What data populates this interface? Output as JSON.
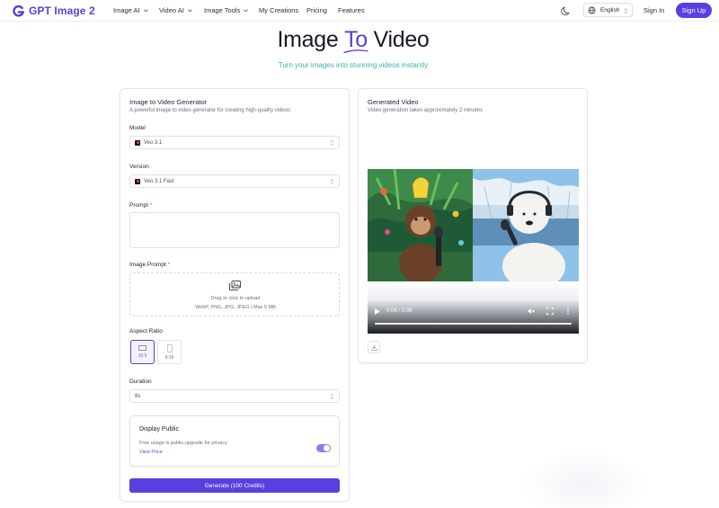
{
  "nav": {
    "logo_text": "GPT Image 2",
    "items": [
      {
        "label": "Image AI",
        "has_chevron": true
      },
      {
        "label": "Video AI",
        "has_chevron": true
      },
      {
        "label": "Image Tools",
        "has_chevron": true
      },
      {
        "label": "My Creations",
        "has_chevron": false
      },
      {
        "label": "Pricing",
        "has_chevron": false
      },
      {
        "label": "Features",
        "has_chevron": false
      }
    ],
    "language": "English",
    "sign_in": "Sign In",
    "sign_up": "Sign Up"
  },
  "hero": {
    "title_prefix": "Image ",
    "title_accent": "To",
    "title_suffix": " Video",
    "subtitle": "Turn your images into stunning videos instantly"
  },
  "generator": {
    "title": "Image to Video Generator",
    "subtitle": "A powerful image to video generator for creating high-quality videos",
    "model_label": "Model",
    "model_value": "Veo 3.1",
    "version_label": "Version",
    "version_value": "Veo 3.1 Fast",
    "prompt_label": "Prompt",
    "image_prompt_label": "Image Prompt",
    "required_mark": "*",
    "upload_text": "Drag or click to upload",
    "upload_formats": "WebP, PNG, JPG, JPEG | Max 5 MB",
    "aspect_label": "Aspect Ratio",
    "aspect_options": [
      "16:9",
      "9:16"
    ],
    "aspect_selected": "16:9",
    "duration_label": "Duration",
    "duration_value": "8s",
    "public_title": "Display Public",
    "public_desc": "Free usage is public,upgrade for privacy",
    "view_price": "View Price",
    "public_enabled": true,
    "generate_label": "Generate (100 Credits)"
  },
  "result": {
    "title": "Generated Video",
    "subtitle": "Video generation takes approximately 2 minutes",
    "time": "0:08 / 0:08",
    "progress": 1.0
  },
  "colors": {
    "brand": "#5b3fd8",
    "button": "#5a3fe0",
    "subtitle": "#3bb3a6",
    "required": "#e0464e"
  }
}
